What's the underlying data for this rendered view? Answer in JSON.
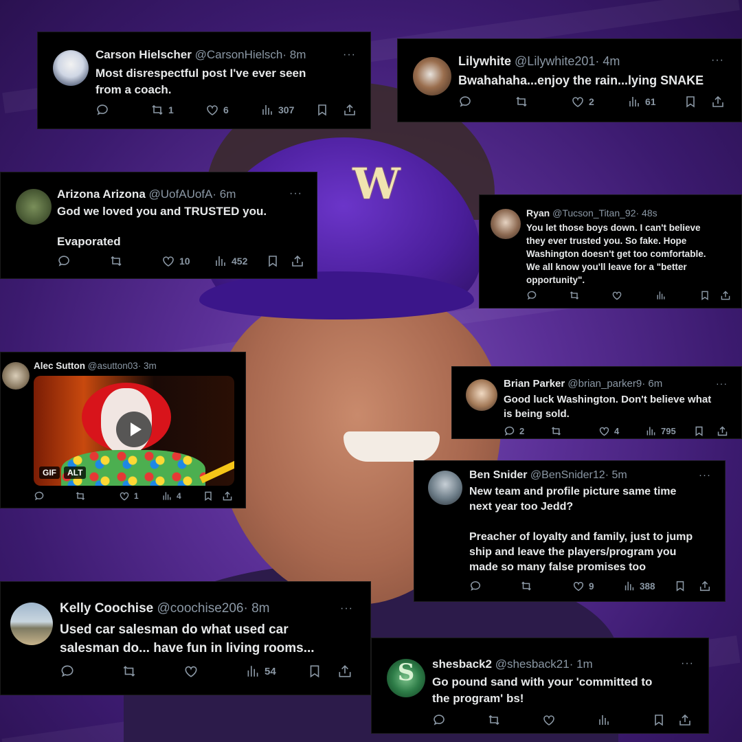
{
  "colors": {
    "accent_purple": "#5a2f96",
    "card_bg": "#000000",
    "muted": "#8b98a5",
    "text": "#e7e9ea"
  },
  "background": {
    "cap_logo": "W"
  },
  "tweets": [
    {
      "name": "Carson Hielscher",
      "handle": "@CarsonHielsch",
      "time": "· 8m",
      "lines": [
        "Most disrespectful post I've ever seen",
        "from a coach."
      ],
      "replies": "",
      "reposts": "1",
      "likes": "6",
      "views": "307"
    },
    {
      "name": "Lilywhite",
      "handle": "@Lilywhite201",
      "time": "· 4m",
      "lines": [
        "Bwahahaha...enjoy the rain...lying SNAKE"
      ],
      "replies": "",
      "reposts": "",
      "likes": "2",
      "views": "61"
    },
    {
      "name": "Arizona Arizona",
      "handle": "@UofAUofA",
      "time": "· 6m",
      "lines": [
        "God we loved you and TRUSTED you.",
        "",
        "Evaporated"
      ],
      "replies": "",
      "reposts": "",
      "likes": "10",
      "views": "452"
    },
    {
      "name": "Ryan",
      "handle": "@Tucson_Titan_92",
      "time": "· 48s",
      "lines": [
        "You let those boys down. I can't believe",
        "they ever trusted you. So fake. Hope",
        "Washington doesn't get too comfortable.",
        "We all know you'll leave for a \"better",
        "opportunity\"."
      ],
      "replies": "",
      "reposts": "",
      "likes": "",
      "views": ""
    },
    {
      "name": "Alec Sutton",
      "handle": "@asutton03",
      "time": "· 3m",
      "lines": [],
      "media_badges": [
        "GIF",
        "ALT"
      ],
      "replies": "",
      "reposts": "",
      "likes": "1",
      "views": "4"
    },
    {
      "name": "Brian Parker",
      "handle": "@brian_parker9",
      "time": "· 6m",
      "lines": [
        "Good luck Washington. Don't believe what",
        "is being sold."
      ],
      "replies": "2",
      "reposts": "",
      "likes": "4",
      "views": "795"
    },
    {
      "name": "Ben Snider",
      "handle": "@BenSnider12",
      "time": "· 5m",
      "lines": [
        "New team and profile picture same time",
        "next year too Jedd?",
        "",
        "Preacher of loyalty and family, just to jump",
        "ship and leave the players/program you",
        "made so many false promises too"
      ],
      "replies": "",
      "reposts": "",
      "likes": "9",
      "views": "388"
    },
    {
      "name": "Kelly Coochise",
      "handle": "@coochise206",
      "time": "· 8m",
      "lines": [
        "Used car salesman do what used car",
        "salesman do... have fun in living rooms..."
      ],
      "replies": "",
      "reposts": "",
      "likes": "",
      "views": "54"
    },
    {
      "name": "shesback2",
      "handle": "@shesback21",
      "time": "· 1m",
      "lines": [
        "Go pound sand with your 'committed to",
        "the program' bs!"
      ],
      "replies": "",
      "reposts": "",
      "likes": "",
      "views": ""
    }
  ],
  "more_glyph": "···"
}
